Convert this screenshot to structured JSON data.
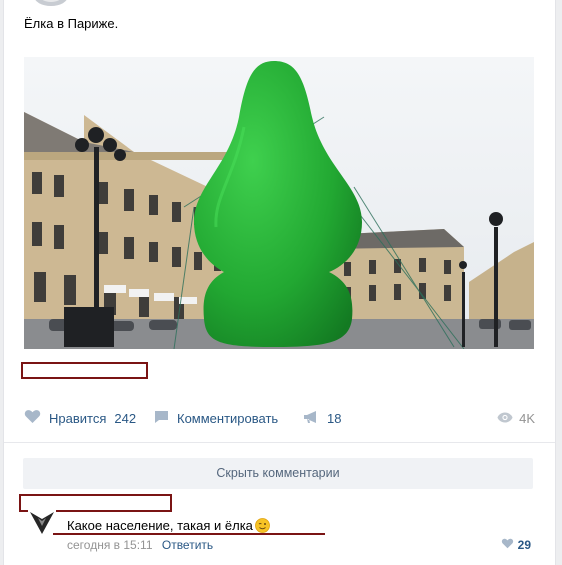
{
  "post": {
    "text": "Ёлка в Париже."
  },
  "actions": {
    "like_label": "Нравится",
    "like_count": "242",
    "comment_label": "Комментировать",
    "share_count": "18",
    "views_count": "4K"
  },
  "comments": {
    "hide_label": "Скрыть комментарии",
    "items": [
      {
        "text": "Какое население, такая и ёлка",
        "time": "сегодня в 15:11",
        "reply_label": "Ответить",
        "likes": "29"
      }
    ]
  },
  "colors": {
    "link": "#2a5885",
    "muted": "#939393",
    "redaction": "#7a1414",
    "tree_green": "#2db43c"
  }
}
